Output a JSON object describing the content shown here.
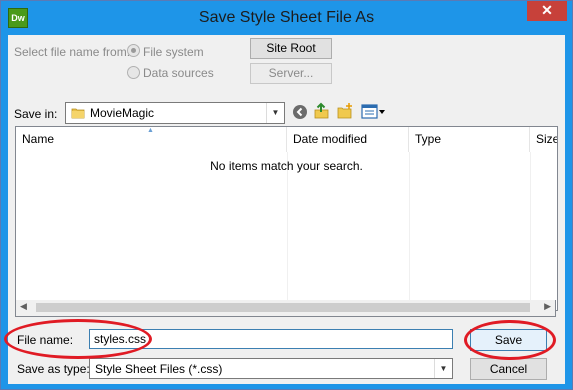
{
  "window": {
    "title": "Save Style Sheet File As",
    "app_icon": "Dw",
    "close_glyph": "✕"
  },
  "source": {
    "label": "Select file name from:",
    "options": [
      {
        "label": "File system",
        "selected": true
      },
      {
        "label": "Data sources",
        "selected": false
      }
    ],
    "site_root_label": "Site Root",
    "server_label": "Server..."
  },
  "location": {
    "save_in_label": "Save in:",
    "folder_name": "MovieMagic",
    "toolbar_icons": [
      "back-icon",
      "up-folder-icon",
      "new-folder-icon",
      "view-menu-icon"
    ]
  },
  "file_list": {
    "columns": [
      "Name",
      "Date modified",
      "Type",
      "Size"
    ],
    "sorted_column": "Name",
    "empty_message": "No items match your search."
  },
  "filename": {
    "label": "File name:",
    "value": "styles.css"
  },
  "filetype": {
    "label": "Save as type:",
    "value": "Style Sheet Files (*.css)"
  },
  "buttons": {
    "save_label": "Save",
    "cancel_label": "Cancel"
  },
  "colors": {
    "titlebar": "#1e95e8",
    "annotation": "#e01b24",
    "close": "#c7413a"
  }
}
